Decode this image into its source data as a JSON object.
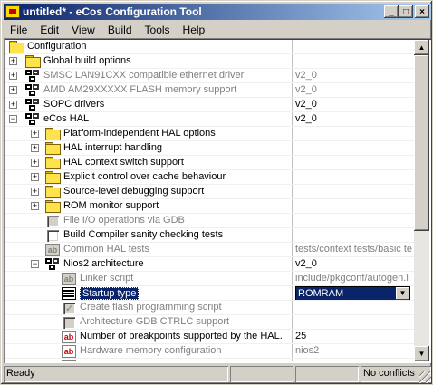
{
  "window": {
    "title": "untitled* - eCos Configuration Tool"
  },
  "titlebar_buttons": {
    "minimize": "_",
    "maximize": "□",
    "close": "×"
  },
  "menu": [
    {
      "label": "File",
      "accel": "F"
    },
    {
      "label": "Edit",
      "accel": "E"
    },
    {
      "label": "View",
      "accel": "V"
    },
    {
      "label": "Build",
      "accel": "B"
    },
    {
      "label": "Tools",
      "accel": "T"
    },
    {
      "label": "Help",
      "accel": "H"
    }
  ],
  "tree": [
    {
      "label": "Configuration",
      "value": "",
      "icon": "folder",
      "expander": "",
      "indent": 0,
      "grey": false
    },
    {
      "label": "Global build options",
      "value": "",
      "icon": "folder",
      "expander": "+",
      "indent": 1,
      "grey": false
    },
    {
      "label": "SMSC LAN91CXX compatible ethernet driver",
      "value": "v2_0",
      "icon": "package",
      "expander": "+",
      "indent": 1,
      "grey": true
    },
    {
      "label": "AMD AM29XXXXX FLASH memory support",
      "value": "v2_0",
      "icon": "package",
      "expander": "+",
      "indent": 1,
      "grey": true
    },
    {
      "label": "SOPC drivers",
      "value": "v2_0",
      "icon": "package",
      "expander": "+",
      "indent": 1,
      "grey": false
    },
    {
      "label": "eCos HAL",
      "value": "v2_0",
      "icon": "package",
      "expander": "-",
      "indent": 1,
      "grey": false
    },
    {
      "label": "Platform-independent HAL options",
      "value": "",
      "icon": "folder",
      "expander": "+",
      "indent": 2,
      "grey": false
    },
    {
      "label": "HAL interrupt handling",
      "value": "",
      "icon": "folder",
      "expander": "+",
      "indent": 2,
      "grey": false
    },
    {
      "label": "HAL context switch support",
      "value": "",
      "icon": "folder",
      "expander": "+",
      "indent": 2,
      "grey": false
    },
    {
      "label": "Explicit control over cache behaviour",
      "value": "",
      "icon": "folder",
      "expander": "+",
      "indent": 2,
      "grey": false
    },
    {
      "label": "Source-level debugging support",
      "value": "",
      "icon": "folder",
      "expander": "+",
      "indent": 2,
      "grey": false
    },
    {
      "label": "ROM monitor support",
      "value": "",
      "icon": "folder",
      "expander": "+",
      "indent": 2,
      "grey": false
    },
    {
      "label": "File I/O operations via GDB",
      "value": "",
      "icon": "checkbox-disabled",
      "expander": "",
      "indent": 2,
      "grey": true
    },
    {
      "label": "Build Compiler sanity checking tests",
      "value": "",
      "icon": "checkbox",
      "expander": "",
      "indent": 2,
      "grey": false
    },
    {
      "label": "Common HAL tests",
      "value": "tests/context tests/basic te",
      "icon": "ab-grey",
      "expander": "",
      "indent": 2,
      "grey": true
    },
    {
      "label": "Nios2 architecture",
      "value": "v2_0",
      "icon": "package",
      "expander": "-",
      "indent": 2,
      "grey": false
    },
    {
      "label": "Linker script",
      "value": "include/pkgconf/autogen.l",
      "icon": "ab-grey",
      "expander": "",
      "indent": 3,
      "grey": true
    },
    {
      "label": "Startup type",
      "value": "ROMRAM",
      "icon": "enum",
      "expander": "",
      "indent": 3,
      "grey": false,
      "selected": true
    },
    {
      "label": "Create flash programming script",
      "value": "",
      "icon": "checkbox-checked-disabled",
      "expander": "",
      "indent": 3,
      "grey": true
    },
    {
      "label": "Architecture GDB CTRLC support",
      "value": "",
      "icon": "checkbox-disabled",
      "expander": "",
      "indent": 3,
      "grey": true
    },
    {
      "label": "Number of breakpoints supported by the HAL.",
      "value": "25",
      "icon": "ab-red",
      "expander": "",
      "indent": 3,
      "grey": false
    },
    {
      "label": "Hardware memory configuration",
      "value": "nios2",
      "icon": "ab-red",
      "expander": "",
      "indent": 3,
      "grey": true
    },
    {
      "label": "",
      "value": "",
      "icon": "ab-grey",
      "expander": "",
      "indent": 3,
      "grey": true
    }
  ],
  "status": {
    "text": "Ready",
    "pane2": "",
    "pane3": "",
    "conflicts": "No conflicts"
  }
}
